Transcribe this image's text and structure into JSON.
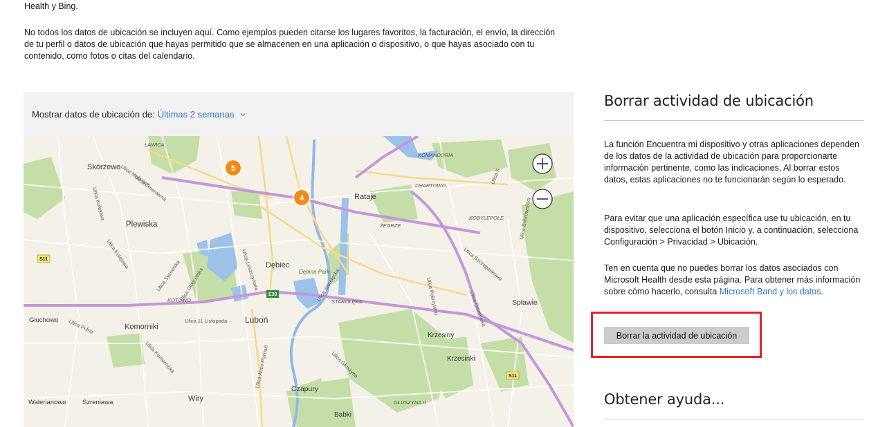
{
  "intro": {
    "top_line": "Health y Bing.",
    "paragraph": "No todos los datos de ubicación se incluyen aquí. Como ejemplos pueden citarse los lugares favoritos, la facturación, el envío, la dirección de tu perfil o datos de ubicación que hayas permitido que se almacenen en una aplicación o dispositivo, o que hayas asociado con tu contenido, como fotos o citas del calendario."
  },
  "map": {
    "header_label": "Mostrar datos de ubicación de:",
    "range_value": "Últimas 2 semanas",
    "clusters": [
      "5",
      "4"
    ],
    "zoom_in_label": "+",
    "zoom_out_label": "−",
    "places": {
      "lawica": "ŁAWICA",
      "komandoria": "KOMANDORIA",
      "skorzewo": "Skórzewo",
      "chartowo": "CHARTOWO",
      "rataje": "Rataje",
      "plewiska": "Plewiska",
      "kobylepole": "KOBYLEPOLE",
      "zegrze": "ŻEGRZE",
      "debiec": "Dębiec",
      "debina_park": "Dębina Park",
      "kotowo": "KOTOWO",
      "starolęka": "STAROŁĘKA",
      "splawie": "Spławie",
      "gluchowo": "Głuchowo",
      "komorniki": "Komorniki",
      "lubon": "Luboń",
      "krzesiny": "Krzesiny",
      "krzesinki": "Krzesinki",
      "czapury": "Czapury",
      "walerianowo": "Walerianowo",
      "szreniawa": "Szreniawa",
      "wiry": "Wiry",
      "babki": "Babki",
      "gluszyna": "GŁUSZYNA II"
    },
    "streets": {
      "cmentarna": "Ulica Cmentarna",
      "malwowa": "Ulica Malwowa",
      "kolejowa1": "Ulica Kolejowa",
      "kolejowa2": "Ulica Kolejowa",
      "sycowska": "Ulica Sycowska",
      "glogowska": "Ulica Głogowska",
      "leszczynska": "Ulica Leszczyńska",
      "starolecka": "Ulica Starołęcka",
      "pokrzywno": "Ulica Pokrzywno",
      "ostrowska": "Ulica Ostrowska",
      "szczepankowo": "Ulica Szczepankowo",
      "bobrownicka": "Ulica Bobrownicka",
      "listopada": "Ulica 11 Listopada",
      "polna": "Ulica Polna",
      "komornicka": "Ulica Komornicka",
      "poznan": "Ulica Armii Poznań",
      "gluszyna_st": "Ulica Głuszyna",
      "k_street": "Ulica K"
    },
    "shields": {
      "s11_a": "S11",
      "s11_b": "S11",
      "e30": "E30"
    }
  },
  "right": {
    "clear_heading": "Borrar actividad de ubicación",
    "p1": "La función Encuentra mi dispositivo y otras aplicaciones dependen de los datos de la actividad de ubicación para proporcionarte información pertinente, como las indicaciones. Al borrar estos datos, estas aplicaciones no te funcionarán según lo esperado.",
    "p2": "Para evitar que una aplicación específica use tu ubicación, en tu dispositivo, selecciona el botón Inicio y, a continuación, selecciona Configuración > Privacidad > Ubicación.",
    "p3_text": "Ten en cuenta que no puedes borrar los datos asociados con Microsoft Health desde esta página. Para obtener más información sobre cómo hacerlo, consulta ",
    "p3_link": "Microsoft Band y los datos",
    "p3_end": ".",
    "clear_button": "Borrar la actividad de ubicación",
    "help_heading": "Obtener ayuda..."
  },
  "colors": {
    "link": "#2b74c7",
    "highlight": "#e3202a",
    "cluster": "#f08c16",
    "highway": "#c497d9",
    "water": "#8fb9e8",
    "green": "#bfdaa0"
  }
}
